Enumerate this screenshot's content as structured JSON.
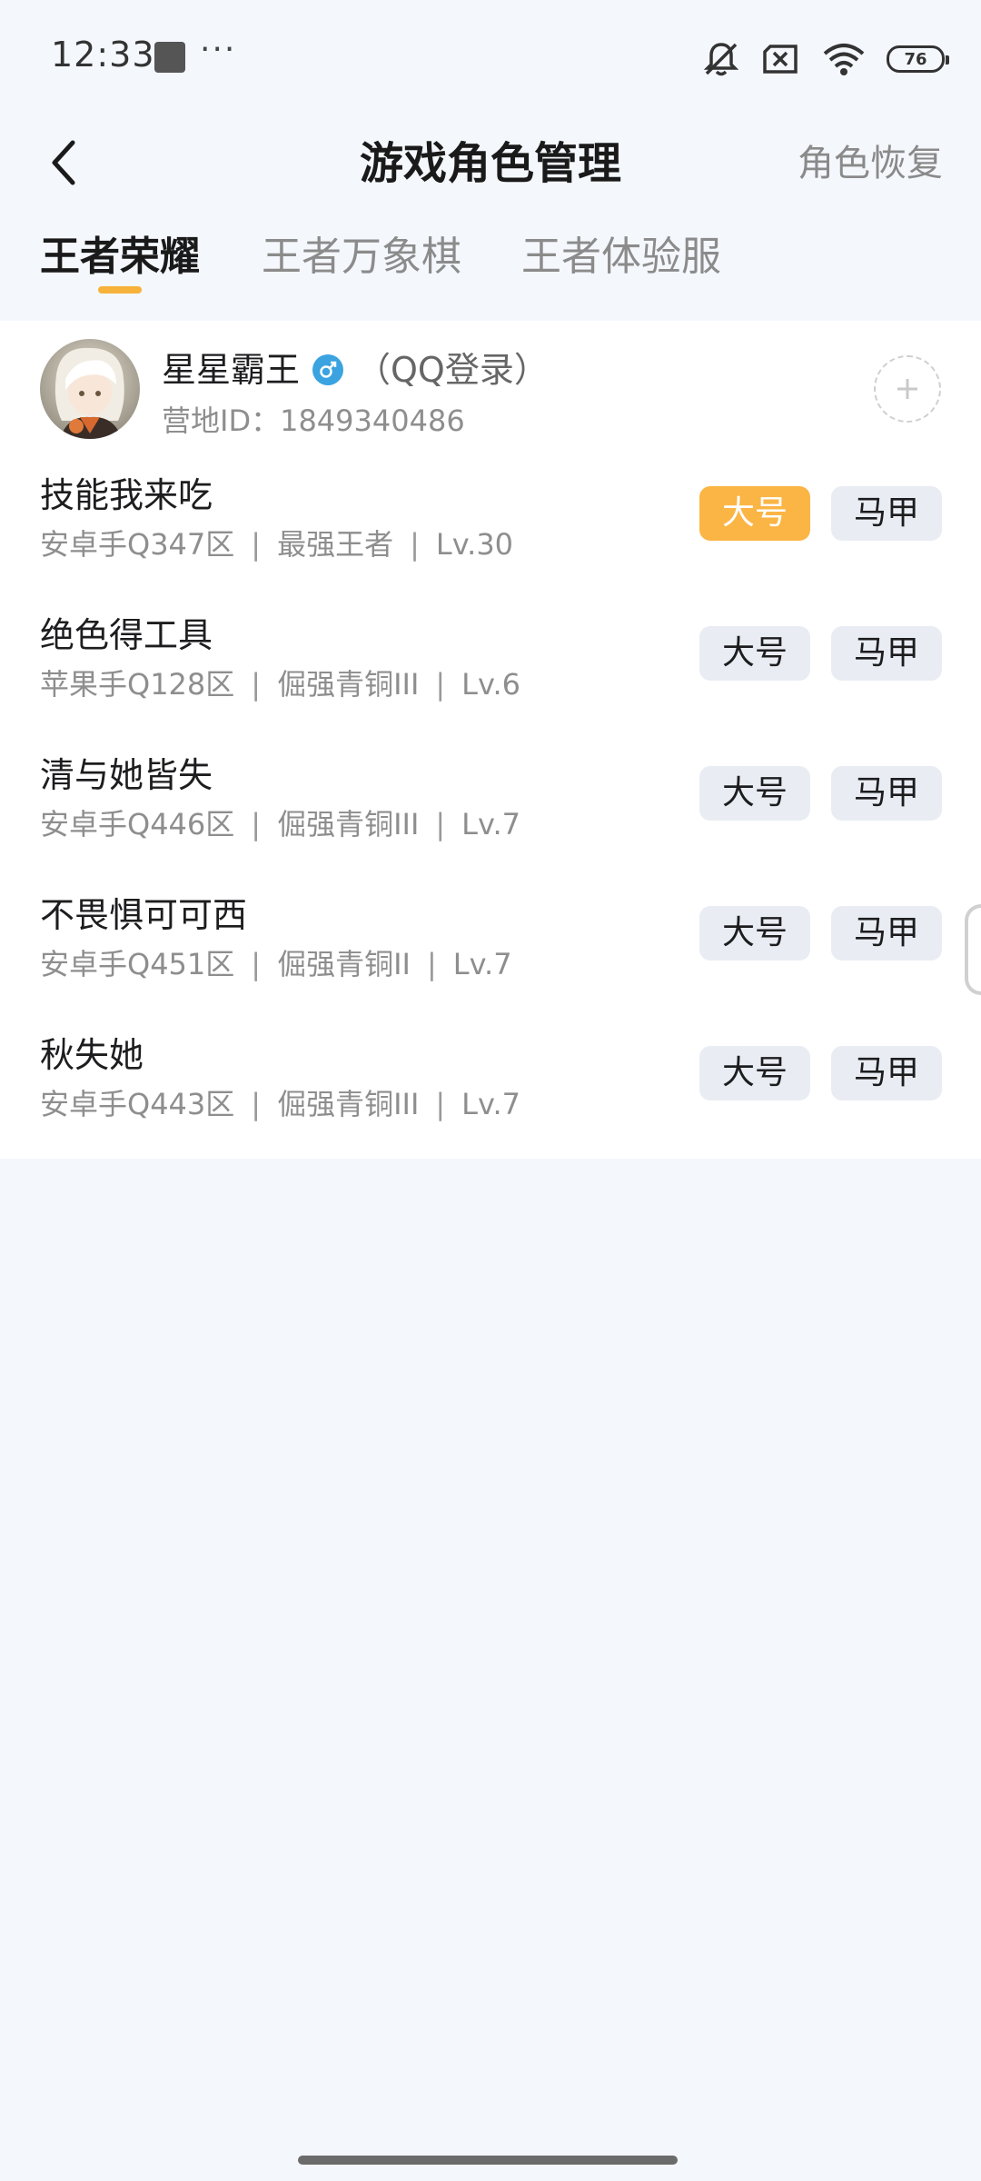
{
  "status_bar": {
    "time": "12:33",
    "more": "···",
    "battery": "76",
    "icons": [
      "image-thumb-icon",
      "mute-bell-icon",
      "sim-off-icon",
      "wifi-icon",
      "battery-icon"
    ]
  },
  "header": {
    "title": "游戏角色管理",
    "action": "角色恢复",
    "back_icon": "chevron-left-icon"
  },
  "tabs": [
    {
      "label": "王者荣耀",
      "active": true
    },
    {
      "label": "王者万象棋",
      "active": false
    },
    {
      "label": "王者体验服",
      "active": false
    }
  ],
  "colors": {
    "accent": "#fbb545",
    "background": "#f4f7fc",
    "card": "#ffffff",
    "tag_bg": "#e9edf3",
    "gender": "#3ba3e0"
  },
  "account": {
    "name": "星星霸王",
    "gender_icon": "male-icon",
    "login_type": "（QQ登录）",
    "id_label": "营地ID：1849340486",
    "add_icon": "plus-icon"
  },
  "roles": [
    {
      "name": "技能我来吃",
      "platform": "安卓手Q347区",
      "rank": "最强王者",
      "level": "Lv.30",
      "main_label": "大号",
      "alt_label": "马甲",
      "selected": "main"
    },
    {
      "name": "绝色得工具",
      "platform": "苹果手Q128区",
      "rank": "倔强青铜III",
      "level": "Lv.6",
      "main_label": "大号",
      "alt_label": "马甲",
      "selected": "none"
    },
    {
      "name": "清与她皆失",
      "platform": "安卓手Q446区",
      "rank": "倔强青铜III",
      "level": "Lv.7",
      "main_label": "大号",
      "alt_label": "马甲",
      "selected": "none"
    },
    {
      "name": "不畏惧可可西",
      "platform": "安卓手Q451区",
      "rank": "倔强青铜II",
      "level": "Lv.7",
      "main_label": "大号",
      "alt_label": "马甲",
      "selected": "none"
    },
    {
      "name": "秋失她",
      "platform": "安卓手Q443区",
      "rank": "倔强青铜III",
      "level": "Lv.7",
      "main_label": "大号",
      "alt_label": "马甲",
      "selected": "none"
    }
  ],
  "separator": "|"
}
